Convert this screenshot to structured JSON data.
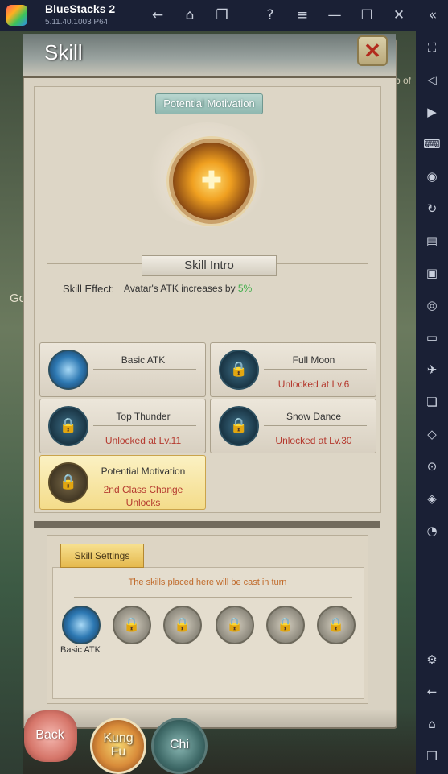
{
  "app": {
    "title": "BlueStacks 2",
    "version": "5.11.40.1003  P64",
    "titlebar_icons": [
      "back-arrow-icon",
      "home-icon",
      "multi-instance-icon",
      "help-icon",
      "menu-icon",
      "minimize-icon",
      "maximize-icon",
      "close-icon"
    ],
    "sidebar_icons": [
      "fullscreen-icon",
      "volume-icon",
      "pointer-icon",
      "keyboard-icon",
      "record-icon",
      "rotate-icon",
      "macro-icon",
      "apk-icon",
      "screenshot-icon",
      "folder-icon",
      "airplane-icon",
      "multi-instance-icon",
      "eco-mode-icon",
      "location-icon",
      "layers-icon",
      "performance-icon",
      "settings-icon",
      "back-icon",
      "home-icon",
      "recent-apps-icon"
    ]
  },
  "background": {
    "left_text": "Go",
    "right_text": "rb of"
  },
  "panel": {
    "title": "Skill",
    "close_label": "✕",
    "selected_skill_name": "Potential Motivation",
    "intro_heading": "Skill Intro",
    "effect_label": "Skill Effect:",
    "effect_text": "Avatar's ATK increases by ",
    "effect_value": "5%",
    "skills": [
      {
        "name": "Basic ATK",
        "status": "",
        "locked": false
      },
      {
        "name": "Full Moon",
        "status": "Unlocked at Lv.6",
        "locked": true
      },
      {
        "name": "Top Thunder",
        "status": "Unlocked at Lv.11",
        "locked": true
      },
      {
        "name": "Snow Dance",
        "status": "Unlocked at Lv.30",
        "locked": true
      },
      {
        "name": "Potential Motivation",
        "status_line1": "2nd Class Change",
        "status_line2": "Unlocks",
        "locked": true,
        "selected": true
      }
    ]
  },
  "settings": {
    "tab_label": "Skill Settings",
    "note": "The skills placed here will be cast in turn",
    "slot_labels": [
      "Basic ATK"
    ],
    "slot_count": 6
  },
  "bottom": {
    "back_label": "Back",
    "kungfu_line1": "Kung",
    "kungfu_line2": "Fu",
    "chi_label": "Chi"
  },
  "colors": {
    "effect_value": "#3fae49",
    "locked_text": "#b53a2f",
    "note_text": "#c06a2a"
  }
}
